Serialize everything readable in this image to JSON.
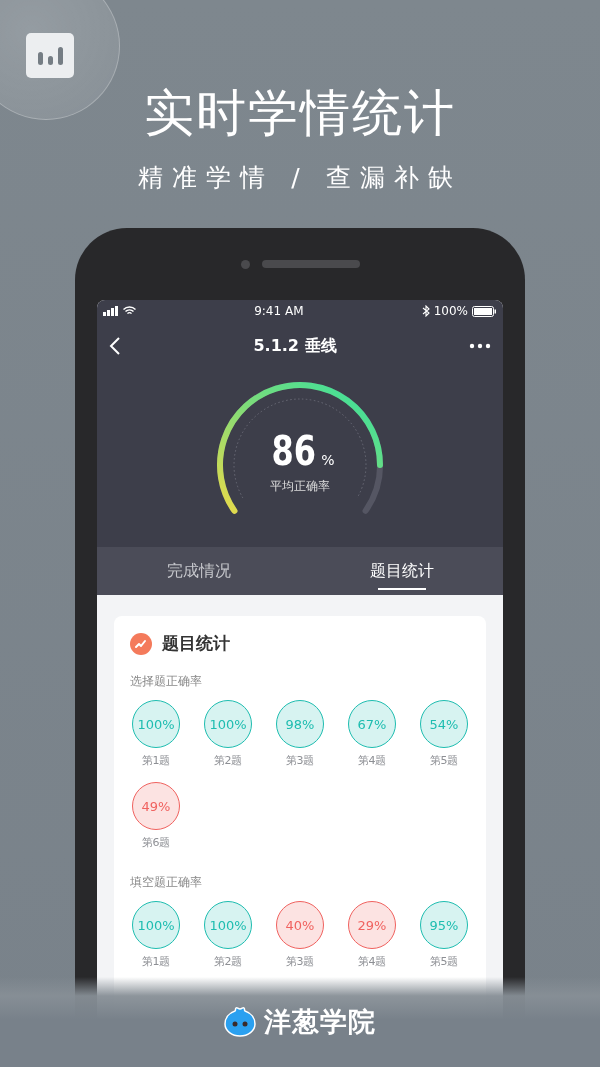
{
  "promo": {
    "title": "实时学情统计",
    "subtitle": "精准学情 / 查漏补缺"
  },
  "status_bar": {
    "time": "9:41 AM",
    "battery": "100%"
  },
  "nav": {
    "title": "5.1.2 垂线"
  },
  "gauge": {
    "value": "86",
    "unit": "%",
    "label": "平均正确率"
  },
  "tabs": [
    {
      "label": "完成情况",
      "selected": false
    },
    {
      "label": "题目统计",
      "selected": true
    }
  ],
  "card": {
    "title": "题目统计",
    "sections": [
      {
        "title": "选择题正确率",
        "items": [
          {
            "value": "100%",
            "label": "第1题",
            "color": "#1ebdb0"
          },
          {
            "value": "100%",
            "label": "第2题",
            "color": "#1ebdb0"
          },
          {
            "value": "98%",
            "label": "第3题",
            "color": "#1ebdb0"
          },
          {
            "value": "67%",
            "label": "第4题",
            "color": "#1ebdb0"
          },
          {
            "value": "54%",
            "label": "第5题",
            "color": "#1ebdb0"
          },
          {
            "value": "49%",
            "label": "第6题",
            "color": "#f0625f"
          }
        ]
      },
      {
        "title": "填空题正确率",
        "items": [
          {
            "value": "100%",
            "label": "第1题",
            "color": "#1ebdb0"
          },
          {
            "value": "100%",
            "label": "第2题",
            "color": "#1ebdb0"
          },
          {
            "value": "40%",
            "label": "第3题",
            "color": "#f0625f"
          },
          {
            "value": "29%",
            "label": "第4题",
            "color": "#f0625f"
          },
          {
            "value": "95%",
            "label": "第5题",
            "color": "#1ebdb0"
          }
        ]
      }
    ]
  },
  "brand": {
    "name": "洋葱学院"
  }
}
